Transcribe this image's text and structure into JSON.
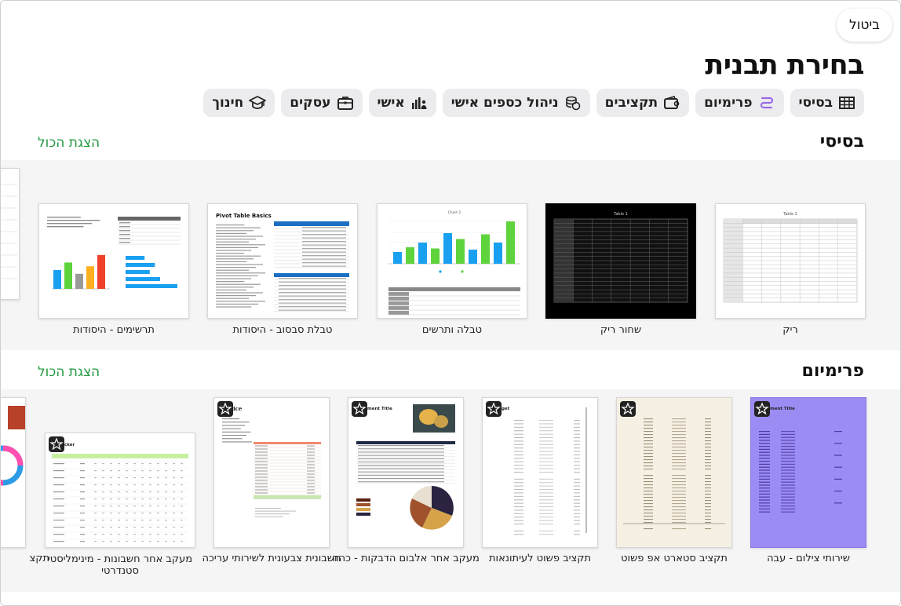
{
  "header": {
    "cancel_label": "ביטול",
    "title": "בחירת תבנית"
  },
  "categories": [
    {
      "label": "בסיסי",
      "icon": "table-icon"
    },
    {
      "label": "פרימיום",
      "icon": "premium-icon"
    },
    {
      "label": "תקציבים",
      "icon": "wallet-icon"
    },
    {
      "label": "ניהול כספים אישי",
      "icon": "coins-icon"
    },
    {
      "label": "אישי",
      "icon": "person-chart-icon"
    },
    {
      "label": "עסקים",
      "icon": "briefcase-icon"
    },
    {
      "label": "חינוך",
      "icon": "graduation-cap-icon"
    }
  ],
  "basic": {
    "title": "בסיסי",
    "show_all": "הצגת הכול",
    "templates": [
      {
        "label": "ריק",
        "thumb_title": "Table 1"
      },
      {
        "label": "שחור ריק",
        "thumb_title": "Table 1"
      },
      {
        "label": "טבלה ותרשים",
        "thumb_title": "Chart 1"
      },
      {
        "label": "טבלת סבסוב - היסודות",
        "thumb_title": "Pivot Table Basics"
      },
      {
        "label": "תרשימים - היסודות",
        "thumb_title": ""
      }
    ]
  },
  "premium": {
    "title": "פרימיום",
    "show_all": "הצגת הכול",
    "templates": [
      {
        "label": "שירותי צילום - עבה",
        "thumb_title": "ment Title"
      },
      {
        "label": "תקציב סטארט אפ פשוט",
        "thumb_title": ""
      },
      {
        "label": "תקציב פשוט לעיתונאות",
        "thumb_title": "get"
      },
      {
        "label": "מעקב אחר אלבום הדבקות - כהה",
        "thumb_title": "ment Title"
      },
      {
        "label": "חשבונית צבעונית לשירותי עריכה",
        "thumb_title": "ice"
      },
      {
        "label": "מעקב אחר חשבונות - מינימליסטי סטנדרטי",
        "thumb_title": "cker"
      },
      {
        "label": "תקצ",
        "thumb_title": ""
      }
    ]
  },
  "colors": {
    "accent_green": "#1f9a3f",
    "chip_bg": "#ececee",
    "premium_purple": "#9b8cf4",
    "bar_blue": "#1aa0f0",
    "bar_green": "#5fd33c"
  }
}
